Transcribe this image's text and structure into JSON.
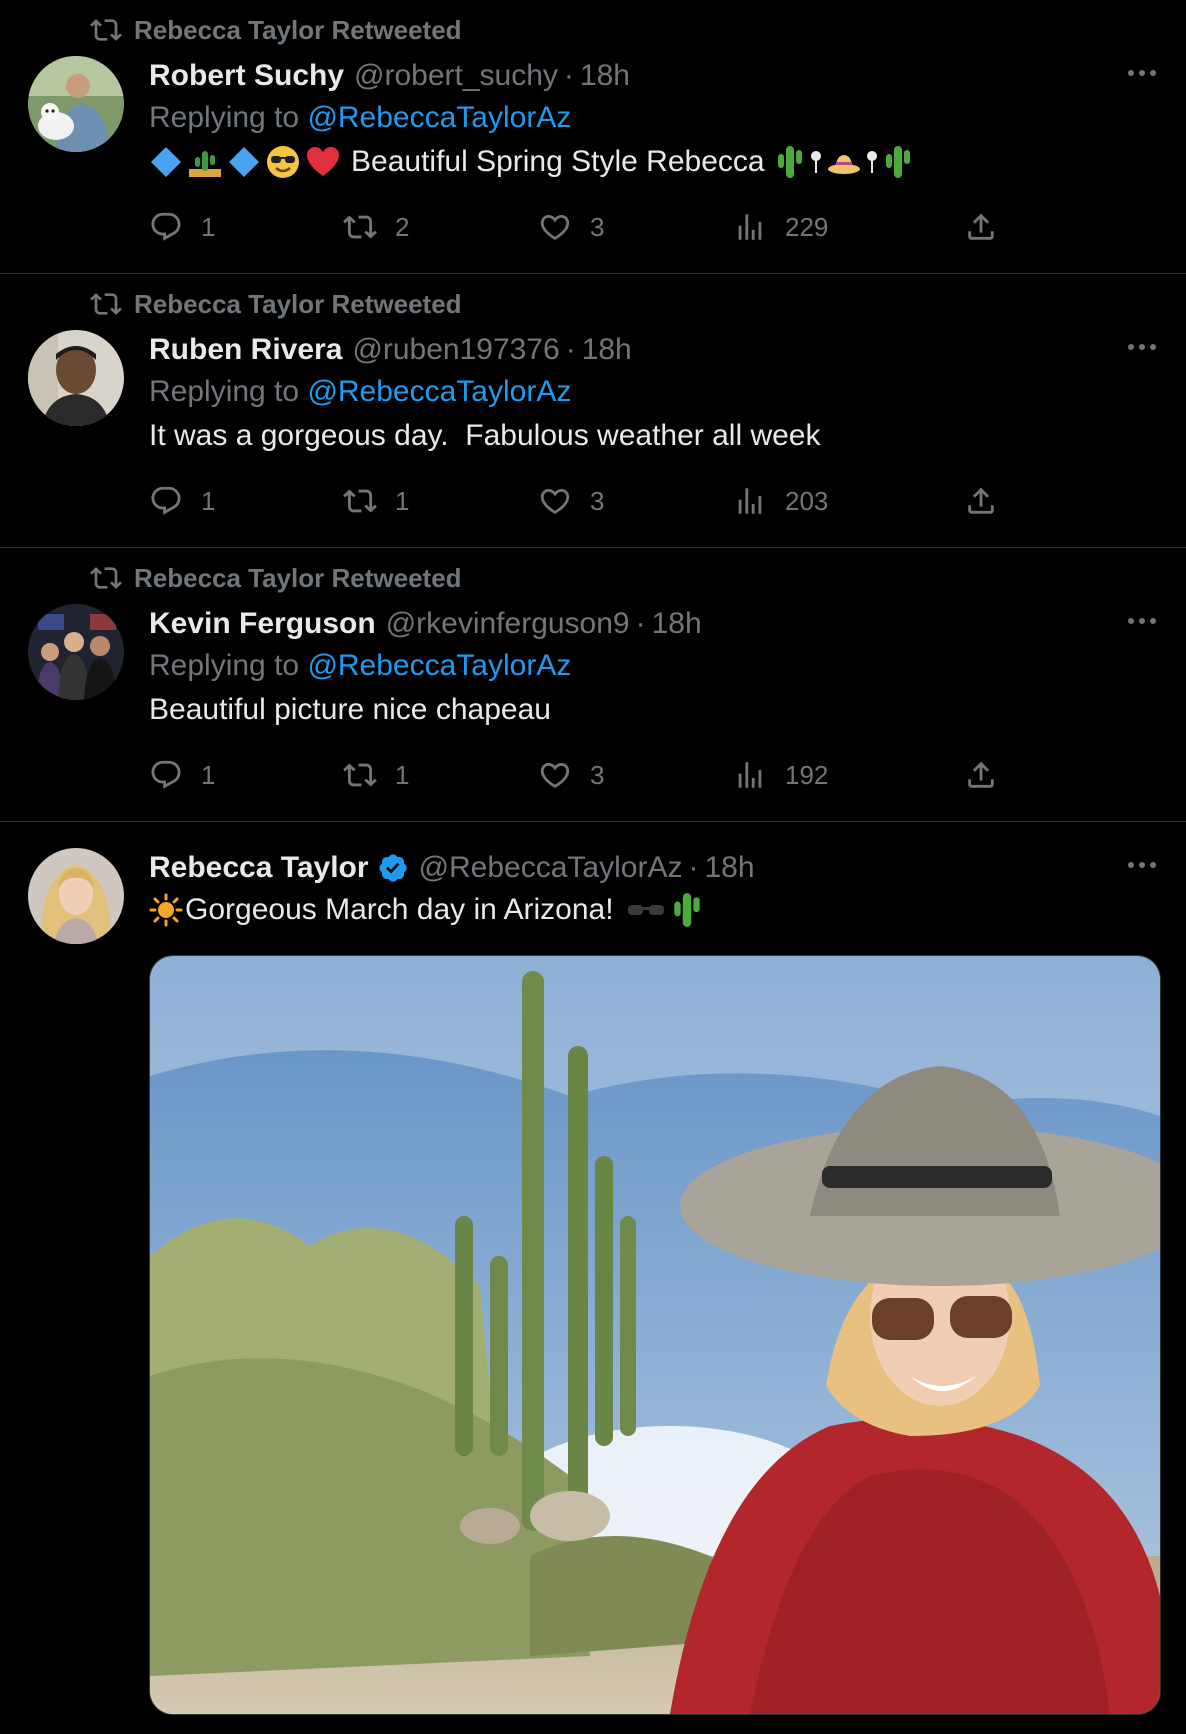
{
  "tweets": [
    {
      "retweeted_by": "Rebecca Taylor Retweeted",
      "name": "Robert Suchy",
      "handle": "@robert_suchy",
      "time": "18h",
      "replying_prefix": "Replying to",
      "replying_mention": "@RebeccaTaylorAz",
      "text": "Beautiful Spring Style Rebecca",
      "stats": {
        "replies": "1",
        "retweets": "2",
        "likes": "3",
        "views": "229"
      }
    },
    {
      "retweeted_by": "Rebecca Taylor Retweeted",
      "name": "Ruben Rivera",
      "handle": "@ruben197376",
      "time": "18h",
      "replying_prefix": "Replying to",
      "replying_mention": "@RebeccaTaylorAz",
      "text": "It was a gorgeous day.  Fabulous weather all week",
      "stats": {
        "replies": "1",
        "retweets": "1",
        "likes": "3",
        "views": "203"
      }
    },
    {
      "retweeted_by": "Rebecca Taylor Retweeted",
      "name": "Kevin Ferguson",
      "handle": "@rkevinferguson9",
      "time": "18h",
      "replying_prefix": "Replying to",
      "replying_mention": "@RebeccaTaylorAz",
      "text": "Beautiful picture nice chapeau",
      "stats": {
        "replies": "1",
        "retweets": "1",
        "likes": "3",
        "views": "192"
      }
    }
  ],
  "main_tweet": {
    "name": "Rebecca Taylor",
    "handle": "@RebeccaTaylorAz",
    "time": "18h",
    "text": "Gorgeous March day in Arizona!"
  },
  "separator": "·",
  "colors": {
    "background": "#000000",
    "text": "#e7e9ea",
    "muted": "#71767b",
    "link": "#1d9bf0",
    "divider": "#2f3336"
  },
  "icons": [
    "retweet-icon",
    "reply-icon",
    "like-icon",
    "views-icon",
    "share-icon",
    "more-icon",
    "verified-badge-icon"
  ]
}
